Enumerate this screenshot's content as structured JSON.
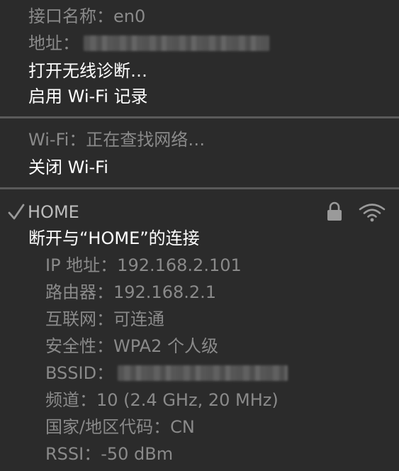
{
  "interface": {
    "name_label": "接口名称：",
    "name_value": "en0",
    "address_label": "地址："
  },
  "actions": {
    "open_diagnostics": "打开无线诊断…",
    "enable_logging": "启用 Wi-Fi 记录"
  },
  "wifi": {
    "status": "Wi-Fi：正在查找网络…",
    "turn_off": "关闭 Wi-Fi"
  },
  "network": {
    "name": "HOME",
    "disconnect": "断开与“HOME”的连接",
    "details": {
      "ip": "IP 地址：192.168.2.101",
      "router": "路由器：192.168.2.1",
      "internet": "互联网：可连通",
      "security": "安全性：WPA2 个人级",
      "bssid_label": "BSSID：",
      "channel": "频道：10 (2.4 GHz, 20 MHz)",
      "country": "国家/地区代码：CN",
      "rssi": "RSSI：-50 dBm"
    }
  },
  "icons": {
    "check": "checkmark-icon",
    "lock": "lock-icon",
    "wifi": "wifi-signal-icon"
  },
  "colors": {
    "background": "#2b2b2b",
    "text_primary": "#ffffff",
    "text_dim": "#8a8a8a",
    "separator": "#5a5a5a"
  }
}
